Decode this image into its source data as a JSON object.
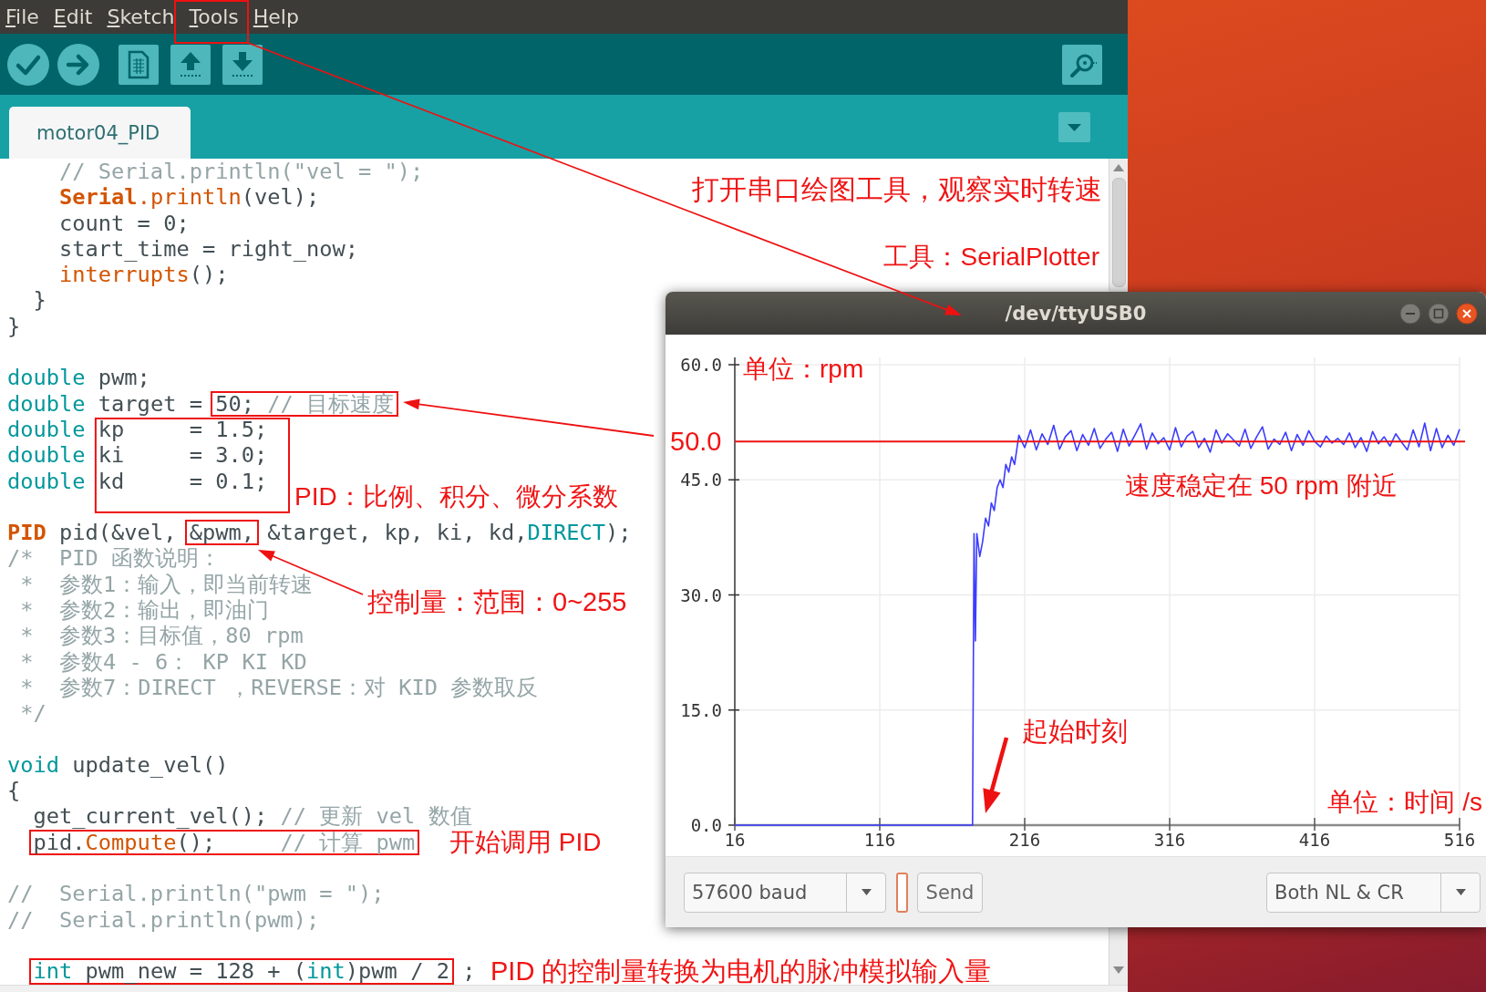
{
  "menu": [
    "File",
    "Edit",
    "Sketch",
    "Tools",
    "Help"
  ],
  "tabs": [
    {
      "label": "motor04_PID",
      "selected": true
    }
  ],
  "code_lines": [
    {
      "kind": "code",
      "tokens": [
        {
          "kind": "comment",
          "text": "    // Serial.println(\"vel = \");"
        }
      ]
    },
    {
      "kind": "code",
      "tokens": [
        {
          "kind": "class",
          "text": "    Serial"
        },
        {
          "kind": "function",
          "text": ".println"
        },
        {
          "kind": "plain",
          "text": "(vel);"
        }
      ]
    },
    {
      "kind": "code",
      "tokens": [
        {
          "kind": "plain",
          "text": "    count = 0;"
        }
      ]
    },
    {
      "kind": "code",
      "tokens": [
        {
          "kind": "plain",
          "text": "    start_time = right_now;"
        }
      ]
    },
    {
      "kind": "code",
      "tokens": [
        {
          "kind": "function",
          "text": "    interrupts"
        },
        {
          "kind": "plain",
          "text": "();"
        }
      ]
    },
    {
      "kind": "code",
      "tokens": [
        {
          "kind": "plain",
          "text": "  }"
        }
      ]
    },
    {
      "kind": "code",
      "tokens": [
        {
          "kind": "plain",
          "text": "}"
        }
      ]
    },
    {
      "kind": "blank"
    },
    {
      "kind": "code",
      "tokens": [
        {
          "kind": "keyword",
          "text": "double"
        },
        {
          "kind": "plain",
          "text": " pwm;"
        }
      ]
    },
    {
      "kind": "code",
      "tokens": [
        {
          "kind": "keyword",
          "text": "double"
        },
        {
          "kind": "plain",
          "text": " target = "
        }
      ],
      "boxed": [
        {
          "kind": "plain",
          "text": "50; "
        },
        {
          "kind": "comment",
          "text": "// 目标速度"
        }
      ]
    },
    {
      "kind": "code",
      "tokens": [
        {
          "kind": "keyword",
          "text": "double"
        },
        {
          "kind": "plain",
          "text": " kp     = 1.5;"
        }
      ]
    },
    {
      "kind": "code",
      "tokens": [
        {
          "kind": "keyword",
          "text": "double"
        },
        {
          "kind": "plain",
          "text": " ki     = 3.0;"
        }
      ]
    },
    {
      "kind": "code",
      "tokens": [
        {
          "kind": "keyword",
          "text": "double"
        },
        {
          "kind": "plain",
          "text": " kd     = 0.1;"
        }
      ]
    },
    {
      "kind": "blank"
    },
    {
      "kind": "code",
      "tokens": [
        {
          "kind": "class",
          "text": "PID"
        },
        {
          "kind": "plain",
          "text": " pid(&vel, "
        }
      ],
      "boxed": [
        {
          "kind": "plain",
          "text": "&pwm,"
        }
      ],
      "tail": [
        {
          "kind": "plain",
          "text": " &target, kp, ki, kd,"
        },
        {
          "kind": "keyword",
          "text": "DIRECT"
        },
        {
          "kind": "plain",
          "text": ");"
        }
      ]
    },
    {
      "kind": "code",
      "tokens": [
        {
          "kind": "comment",
          "text": "/*  PID 函数说明："
        }
      ]
    },
    {
      "kind": "code",
      "tokens": [
        {
          "kind": "comment",
          "text": " *  参数1：输入，即当前转速"
        }
      ]
    },
    {
      "kind": "code",
      "tokens": [
        {
          "kind": "comment",
          "text": " *  参数2：输出，即油门"
        }
      ]
    },
    {
      "kind": "code",
      "tokens": [
        {
          "kind": "comment",
          "text": " *  参数3：目标值，80 rpm"
        }
      ]
    },
    {
      "kind": "code",
      "tokens": [
        {
          "kind": "comment",
          "text": " *  参数4 - 6： KP KI KD"
        }
      ]
    },
    {
      "kind": "code",
      "tokens": [
        {
          "kind": "comment",
          "text": " *  参数7：DIRECT ，REVERSE：对 KID 参数取反"
        }
      ]
    },
    {
      "kind": "code",
      "tokens": [
        {
          "kind": "comment",
          "text": " */"
        }
      ]
    },
    {
      "kind": "blank"
    },
    {
      "kind": "code",
      "tokens": [
        {
          "kind": "keyword",
          "text": "void"
        },
        {
          "kind": "plain",
          "text": " update_vel()"
        }
      ]
    },
    {
      "kind": "code",
      "tokens": [
        {
          "kind": "plain",
          "text": "{"
        }
      ]
    },
    {
      "kind": "code",
      "tokens": [
        {
          "kind": "plain",
          "text": "  get_current_vel(); "
        },
        {
          "kind": "comment",
          "text": "// 更新 vel 数值"
        }
      ]
    },
    {
      "kind": "code",
      "boxed": [
        {
          "kind": "plain",
          "text": "  pid."
        },
        {
          "kind": "function",
          "text": "Compute"
        },
        {
          "kind": "plain",
          "text": "();     "
        },
        {
          "kind": "comment",
          "text": "// 计算 pwm"
        }
      ]
    },
    {
      "kind": "blank"
    },
    {
      "kind": "code",
      "tokens": [
        {
          "kind": "comment",
          "text": "//  Serial.println(\"pwm = \");"
        }
      ]
    },
    {
      "kind": "code",
      "tokens": [
        {
          "kind": "comment",
          "text": "//  Serial.println(pwm);"
        }
      ]
    },
    {
      "kind": "blank"
    },
    {
      "kind": "code",
      "boxed": [
        {
          "kind": "keyword",
          "text": "  int"
        },
        {
          "kind": "plain",
          "text": " pwm_new = 128 + ("
        },
        {
          "kind": "keyword",
          "text": "int"
        },
        {
          "kind": "plain",
          "text": ")pwm / 2"
        }
      ],
      "tail": [
        {
          "kind": "plain",
          "text": " ;"
        }
      ]
    }
  ],
  "plotter": {
    "title": "/dev/ttyUSB0",
    "chart_data": {
      "type": "line",
      "grid": true,
      "x": [
        16,
        180,
        181,
        182,
        183,
        185,
        187,
        189,
        191,
        193,
        195,
        197,
        199,
        201,
        203,
        205,
        207,
        209,
        212,
        216,
        220,
        224,
        228,
        232,
        236,
        240,
        244,
        248,
        252,
        256,
        260,
        264,
        268,
        272,
        276,
        280,
        284,
        288,
        292,
        296,
        300,
        304,
        308,
        312,
        316,
        320,
        324,
        328,
        332,
        336,
        340,
        344,
        348,
        352,
        356,
        360,
        364,
        368,
        372,
        376,
        380,
        384,
        388,
        392,
        396,
        400,
        404,
        408,
        412,
        416,
        420,
        424,
        428,
        432,
        436,
        440,
        444,
        448,
        452,
        456,
        460,
        464,
        468,
        472,
        476,
        480,
        484,
        488,
        492,
        496,
        500,
        504,
        508,
        512,
        516
      ],
      "series": [
        {
          "color": "#3c3cff",
          "values": [
            0,
            0,
            38,
            24,
            38,
            35,
            37,
            40,
            39,
            42,
            41,
            44,
            45,
            44,
            47,
            46,
            48,
            47,
            50.8,
            49.2,
            51.5,
            48.9,
            51.0,
            49.6,
            52.1,
            49.0,
            50.6,
            51.4,
            48.8,
            50.9,
            49.5,
            51.7,
            49.1,
            50.3,
            51.2,
            48.7,
            51.6,
            49.4,
            50.8,
            52.3,
            49.0,
            51.1,
            49.7,
            50.5,
            48.9,
            51.8,
            49.3,
            50.7,
            51.3,
            49.2,
            50.4,
            48.6,
            51.5,
            49.8,
            51.0,
            50.2,
            49.4,
            51.6,
            49.1,
            50.6,
            51.9,
            49.0,
            50.3,
            49.6,
            51.2,
            48.8,
            50.9,
            49.5,
            51.4,
            50.0,
            49.3,
            50.7,
            49.8,
            50.4,
            49.6,
            51.1,
            49.2,
            50.5,
            48.7,
            51.3,
            49.7,
            50.6,
            49.4,
            51.0,
            49.9,
            48.9,
            51.5,
            49.3,
            52.4,
            48.8,
            51.7,
            49.2,
            50.8,
            49.5,
            51.6
          ]
        }
      ],
      "xlim": [
        16,
        516
      ],
      "ylim": [
        0,
        60
      ],
      "xticks": [
        16,
        116,
        216,
        316,
        416,
        516
      ],
      "yticks": [
        {
          "value": 0,
          "label": "0.0"
        },
        {
          "value": 15,
          "label": "15.0"
        },
        {
          "value": 30,
          "label": "30.0"
        },
        {
          "value": 45,
          "label": "45.0"
        },
        {
          "value": 60,
          "label": "60.0"
        }
      ]
    },
    "baud_select": "57600 baud",
    "send_button": "Send",
    "line_ending_select": "Both NL & CR"
  },
  "annotations": [
    "打开串口绘图工具，观察实时转速",
    "工具：SerialPlotter",
    "单位：rpm",
    "50.0",
    "PID：比例、积分、微分系数",
    "速度稳定在 50 rpm 附近",
    "控制量：范围：0~255",
    "起始时刻",
    "单位：时间 /s",
    "开始调用 PID",
    "PID 的控制量转换为电机的脉冲模拟输入量"
  ]
}
